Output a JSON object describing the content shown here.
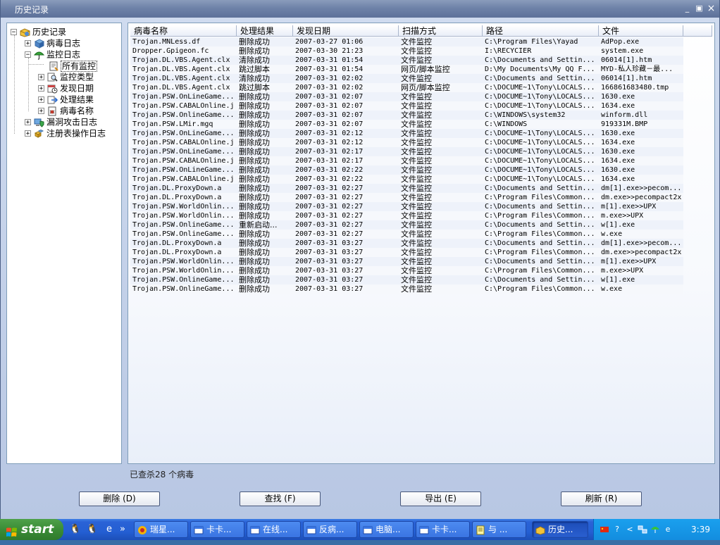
{
  "window": {
    "title": "历史记录",
    "minimize": "_",
    "maximize": "▣",
    "close": "×"
  },
  "tree": {
    "root": "历史记录",
    "items": [
      {
        "label": "病毒日志"
      },
      {
        "label": "监控日志"
      },
      {
        "label": "所有监控"
      },
      {
        "label": "监控类型"
      },
      {
        "label": "发现日期"
      },
      {
        "label": "处理结果"
      },
      {
        "label": "病毒名称"
      },
      {
        "label": "漏洞攻击日志"
      },
      {
        "label": "注册表操作日志"
      }
    ]
  },
  "list": {
    "columns": [
      "病毒名称",
      "处理结果",
      "发现日期",
      "扫描方式",
      "路径",
      "文件"
    ],
    "rows": [
      [
        "Trojan.MNLess.df",
        "删除成功",
        "2007-03-27 01:06",
        "文件监控",
        "C:\\Program Files\\Yayad",
        "AdPop.exe"
      ],
      [
        "Dropper.Gpigeon.fc",
        "删除成功",
        "2007-03-30 21:23",
        "文件监控",
        "I:\\RECYCIER",
        "system.exe"
      ],
      [
        "Trojan.DL.VBS.Agent.clx",
        "清除成功",
        "2007-03-31 01:54",
        "文件监控",
        "C:\\Documents and Settin...",
        "06014[1].htm"
      ],
      [
        "Trojan.DL.VBS.Agent.clx",
        "跳过脚本",
        "2007-03-31 01:54",
        "网页/脚本监控",
        "D:\\My Documents\\My QQ F...",
        "MYD-私人珍藏－最..."
      ],
      [
        "Trojan.DL.VBS.Agent.clx",
        "清除成功",
        "2007-03-31 02:02",
        "文件监控",
        "C:\\Documents and Settin...",
        "06014[1].htm"
      ],
      [
        "Trojan.DL.VBS.Agent.clx",
        "跳过脚本",
        "2007-03-31 02:02",
        "网页/脚本监控",
        "C:\\DOCUME~1\\Tony\\LOCALS...",
        "166861683480.tmp"
      ],
      [
        "Trojan.PSW.OnLineGame...",
        "删除成功",
        "2007-03-31 02:07",
        "文件监控",
        "C:\\DOCUME~1\\Tony\\LOCALS...",
        "1630.exe"
      ],
      [
        "Trojan.PSW.CABALOnline.j",
        "删除成功",
        "2007-03-31 02:07",
        "文件监控",
        "C:\\DOCUME~1\\Tony\\LOCALS...",
        "1634.exe"
      ],
      [
        "Trojan.PSW.OnlineGame...",
        "删除成功",
        "2007-03-31 02:07",
        "文件监控",
        "C:\\WINDOWS\\system32",
        "winform.dll"
      ],
      [
        "Trojan.PSW.LMir.mgq",
        "删除成功",
        "2007-03-31 02:07",
        "文件监控",
        "C:\\WINDOWS",
        "919331M.BMP"
      ],
      [
        "Trojan.PSW.OnLineGame...",
        "删除成功",
        "2007-03-31 02:12",
        "文件监控",
        "C:\\DOCUME~1\\Tony\\LOCALS...",
        "1630.exe"
      ],
      [
        "Trojan.PSW.CABALOnline.j",
        "删除成功",
        "2007-03-31 02:12",
        "文件监控",
        "C:\\DOCUME~1\\Tony\\LOCALS...",
        "1634.exe"
      ],
      [
        "Trojan.PSW.OnLineGame...",
        "删除成功",
        "2007-03-31 02:17",
        "文件监控",
        "C:\\DOCUME~1\\Tony\\LOCALS...",
        "1630.exe"
      ],
      [
        "Trojan.PSW.CABALOnline.j",
        "删除成功",
        "2007-03-31 02:17",
        "文件监控",
        "C:\\DOCUME~1\\Tony\\LOCALS...",
        "1634.exe"
      ],
      [
        "Trojan.PSW.OnLineGame...",
        "删除成功",
        "2007-03-31 02:22",
        "文件监控",
        "C:\\DOCUME~1\\Tony\\LOCALS...",
        "1630.exe"
      ],
      [
        "Trojan.PSW.CABALOnline.j",
        "删除成功",
        "2007-03-31 02:22",
        "文件监控",
        "C:\\DOCUME~1\\Tony\\LOCALS...",
        "1634.exe"
      ],
      [
        "Trojan.DL.ProxyDown.a",
        "删除成功",
        "2007-03-31 02:27",
        "文件监控",
        "C:\\Documents and Settin...",
        "dm[1].exe>>pecom..."
      ],
      [
        "Trojan.DL.ProxyDown.a",
        "删除成功",
        "2007-03-31 02:27",
        "文件监控",
        "C:\\Program Files\\Common...",
        "dm.exe>>pecompact2x"
      ],
      [
        "Trojan.PSW.WorldOnlin...",
        "删除成功",
        "2007-03-31 02:27",
        "文件监控",
        "C:\\Documents and Settin...",
        "m[1].exe>>UPX"
      ],
      [
        "Trojan.PSW.WorldOnlin...",
        "删除成功",
        "2007-03-31 02:27",
        "文件监控",
        "C:\\Program Files\\Common...",
        "m.exe>>UPX"
      ],
      [
        "Trojan.PSW.OnlineGame...",
        "重新启动...",
        "2007-03-31 02:27",
        "文件监控",
        "C:\\Documents and Settin...",
        "w[1].exe"
      ],
      [
        "Trojan.PSW.OnlineGame...",
        "删除成功",
        "2007-03-31 02:27",
        "文件监控",
        "C:\\Program Files\\Common...",
        "w.exe"
      ],
      [
        "Trojan.DL.ProxyDown.a",
        "删除成功",
        "2007-03-31 03:27",
        "文件监控",
        "C:\\Documents and Settin...",
        "dm[1].exe>>pecom..."
      ],
      [
        "Trojan.DL.ProxyDown.a",
        "删除成功",
        "2007-03-31 03:27",
        "文件监控",
        "C:\\Program Files\\Common...",
        "dm.exe>>pecompact2x"
      ],
      [
        "Trojan.PSW.WorldOnlin...",
        "删除成功",
        "2007-03-31 03:27",
        "文件监控",
        "C:\\Documents and Settin...",
        "m[1].exe>>UPX"
      ],
      [
        "Trojan.PSW.WorldOnlin...",
        "删除成功",
        "2007-03-31 03:27",
        "文件监控",
        "C:\\Program Files\\Common...",
        "m.exe>>UPX"
      ],
      [
        "Trojan.PSW.OnlineGame...",
        "删除成功",
        "2007-03-31 03:27",
        "文件监控",
        "C:\\Documents and Settin...",
        "w[1].exe"
      ],
      [
        "Trojan.PSW.OnlineGame...",
        "删除成功",
        "2007-03-31 03:27",
        "文件监控",
        "C:\\Program Files\\Common...",
        "w.exe"
      ]
    ]
  },
  "status": "已查杀28 个病毒",
  "buttons": {
    "delete": "删除 (D)",
    "find": "查找 (F)",
    "export": "导出 (E)",
    "refresh": "刷新 (R)"
  },
  "taskbar": {
    "start": "start",
    "quicklaunch_more": "»",
    "tasks": [
      "瑞星...",
      "卡卡...",
      "在线...",
      "反病...",
      "电脑...",
      "卡卡...",
      "与 ...",
      "历史..."
    ],
    "active_index": 7,
    "tray_more": "<",
    "clock": "3:39"
  }
}
